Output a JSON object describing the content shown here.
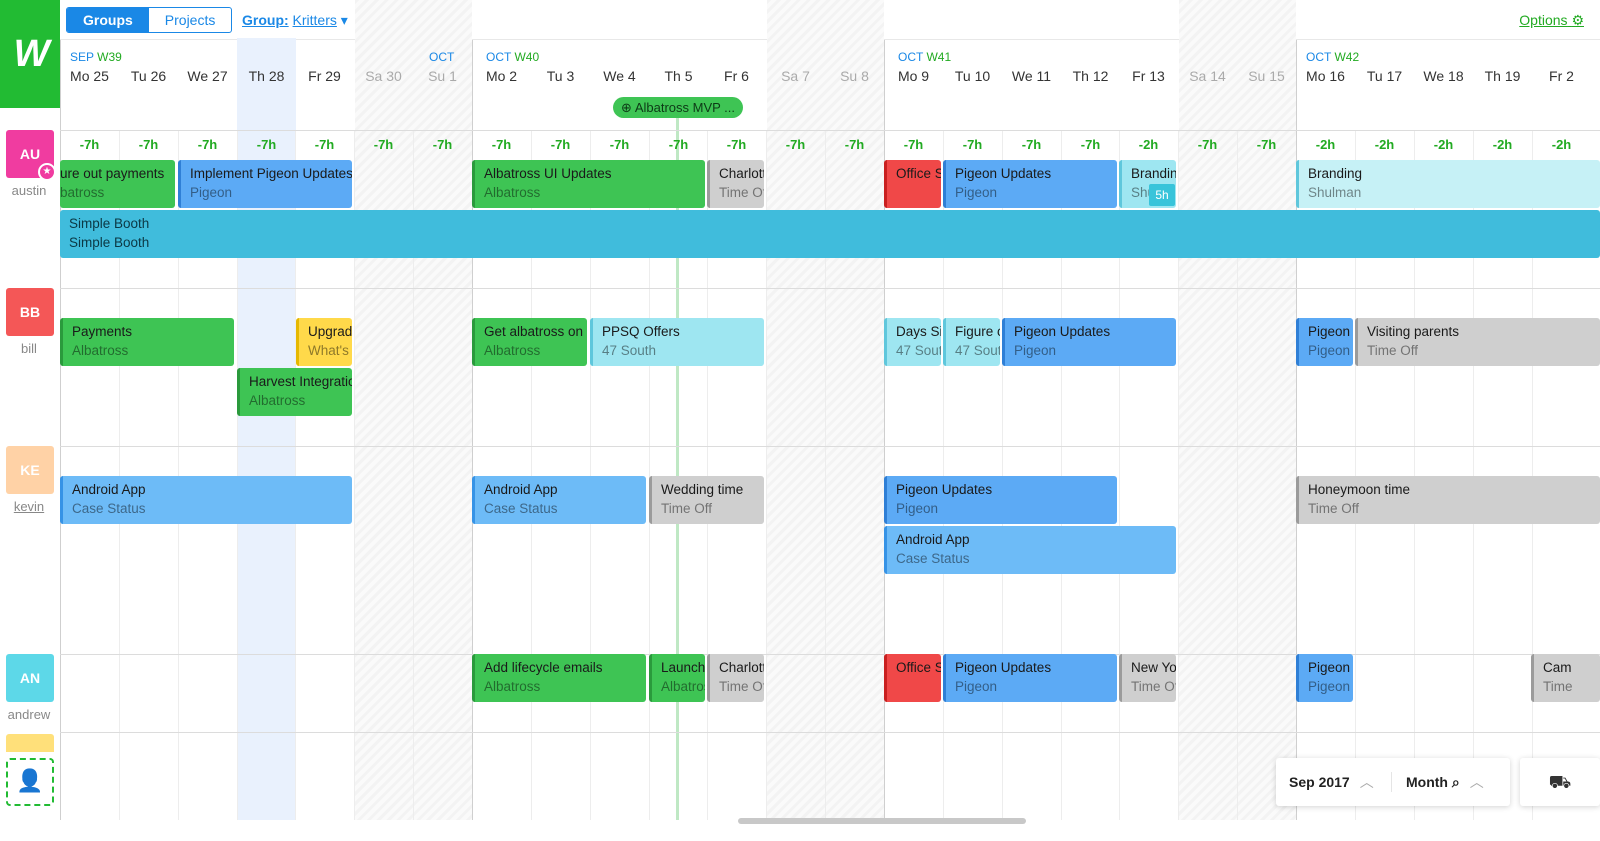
{
  "toolbar": {
    "tab_groups": "Groups",
    "tab_projects": "Projects",
    "group_label": "Group:",
    "group_value": "Kritters",
    "options": "Options"
  },
  "logo_text": "W",
  "weeks": [
    {
      "month": "SEP",
      "week": "W39"
    },
    {
      "month": "OCT",
      "week": ""
    },
    {
      "month": "OCT",
      "week": "W40"
    },
    {
      "month": "OCT",
      "week": "W41"
    },
    {
      "month": "OCT",
      "week": "W42"
    }
  ],
  "days": [
    "Mo 25",
    "Tu 26",
    "We 27",
    "Th 28",
    "Fr 29",
    "Sa 30",
    "Su 1",
    "Mo 2",
    "Tu 3",
    "We 4",
    "Th 5",
    "Fr 6",
    "Sa 7",
    "Su 8",
    "Mo 9",
    "Tu 10",
    "We 11",
    "Th 12",
    "Fr 13",
    "Sa 14",
    "Su 15",
    "Mo 16",
    "Tu 17",
    "We 18",
    "Th 19",
    "Fr 2"
  ],
  "milestone": "Albatross MVP ...",
  "hours": [
    "-7h",
    "-7h",
    "-7h",
    "-7h",
    "-7h",
    "-7h",
    "-7h",
    "-7h",
    "-7h",
    "-7h",
    "-7h",
    "-7h",
    "-7h",
    "-7h",
    "-7h",
    "-7h",
    "-7h",
    "-7h",
    "-2h",
    "-7h",
    "-7h",
    "-2h",
    "-2h",
    "-2h",
    "-2h",
    "-2h"
  ],
  "people": [
    {
      "initials": "AU",
      "name": "austin",
      "color": "#f03ca0"
    },
    {
      "initials": "BB",
      "name": "bill",
      "color": "#f45757"
    },
    {
      "initials": "KE",
      "name": "kevin",
      "color": "#ffd2a6"
    },
    {
      "initials": "AN",
      "name": "andrew",
      "color": "#5dd8e8"
    }
  ],
  "tasks": {
    "au1": {
      "title": "ure out payments",
      "project": "batross"
    },
    "au2": {
      "title": "Implement Pigeon Updates",
      "project": "Pigeon"
    },
    "au3": {
      "title": "Albatross UI Updates",
      "project": "Albatross"
    },
    "au4": {
      "title": "Charlott",
      "project": "Time Of"
    },
    "au5": {
      "title": "Office S",
      "project": ""
    },
    "au6": {
      "title": "Pigeon Updates",
      "project": "Pigeon"
    },
    "au7": {
      "title": "Brandin",
      "project": "Shu"
    },
    "au7_badge": "5h",
    "au8": {
      "title": "Branding",
      "project": "Shulman"
    },
    "au9": {
      "title": "Simple Booth",
      "project": "Simple Booth"
    },
    "bb1": {
      "title": "Payments",
      "project": "Albatross"
    },
    "bb2": {
      "title": "Upgrad",
      "project": "What's"
    },
    "bb3": {
      "title": "Harvest Integratio",
      "project": "Albatross"
    },
    "bb4": {
      "title": "Get albatross on s",
      "project": "Albatross"
    },
    "bb5": {
      "title": "PPSQ Offers",
      "project": "47 South"
    },
    "bb6": {
      "title": "Days Si",
      "project": "47 Sout"
    },
    "bb7": {
      "title": "Figure c",
      "project": "47 Sout"
    },
    "bb8": {
      "title": "Pigeon Updates",
      "project": "Pigeon"
    },
    "bb9": {
      "title": "Pigeon",
      "project": "Pigeon"
    },
    "bb10": {
      "title": "Visiting parents",
      "project": "Time Off"
    },
    "ke1": {
      "title": "Android App",
      "project": "Case Status"
    },
    "ke2": {
      "title": "Android App",
      "project": "Case Status"
    },
    "ke3": {
      "title": "Wedding time",
      "project": "Time Off"
    },
    "ke4": {
      "title": "Pigeon Updates",
      "project": "Pigeon"
    },
    "ke5": {
      "title": "Android App",
      "project": "Case Status"
    },
    "ke6": {
      "title": "Honeymoon time",
      "project": "Time Off"
    },
    "an1": {
      "title": "Add lifecycle emails",
      "project": "Albatross"
    },
    "an2": {
      "title": "Launch",
      "project": "Albatros"
    },
    "an3": {
      "title": "Charlott",
      "project": "Time Of"
    },
    "an4": {
      "title": "Office S",
      "project": ""
    },
    "an5": {
      "title": "Pigeon Updates",
      "project": "Pigeon"
    },
    "an6": {
      "title": "New Yo",
      "project": "Time Of"
    },
    "an7": {
      "title": "Pigeon",
      "project": "Pigeon"
    },
    "an8": {
      "title": "Cam",
      "project": "Time"
    }
  },
  "controls": {
    "date": "Sep 2017",
    "range": "Month"
  }
}
